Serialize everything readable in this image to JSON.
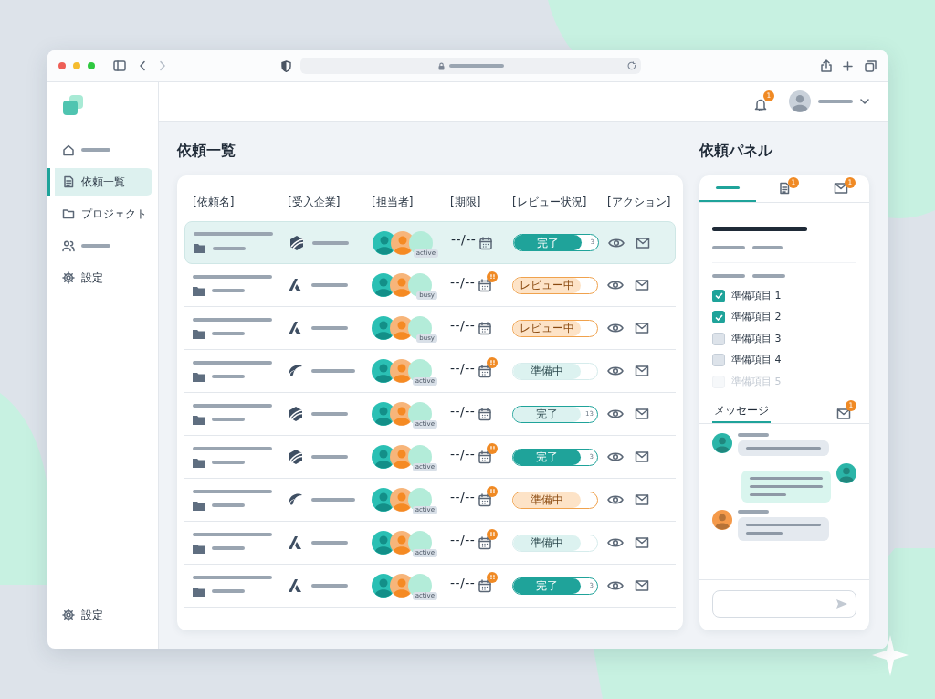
{
  "sidebar": {
    "items": [
      {
        "selected": false
      },
      {
        "label": "依頼一覧",
        "selected": true
      },
      {
        "label": "プロジェクト",
        "selected": false
      },
      {
        "selected": false
      },
      {
        "label": "設定",
        "selected": false
      }
    ],
    "footer": {
      "label": "設定"
    }
  },
  "header": {
    "notification_badge": "1"
  },
  "main": {
    "title": "依頼一覧",
    "table": {
      "columns": [
        "[依頼名]",
        "[受入企業]",
        "[担当者]",
        "[期限]",
        "[レビュー状況]",
        "[アクション]"
      ],
      "rows": [
        {
          "selected": true,
          "company": {
            "kind": "hex"
          },
          "status": "active",
          "deadline": "--/--",
          "review": {
            "label": "完了",
            "kind": "filled",
            "level": 0.8,
            "count": "3"
          }
        },
        {
          "selected": false,
          "company": {
            "kind": "peak"
          },
          "status": "busy",
          "deadline": "--/--",
          "alert": "!!",
          "review": {
            "label": "レビュー中",
            "kind": "warm",
            "level": 0.8
          }
        },
        {
          "selected": false,
          "company": {
            "kind": "peak"
          },
          "status": "busy",
          "deadline": "--/--",
          "review": {
            "label": "レビュー中",
            "kind": "warm",
            "level": 0.8
          }
        },
        {
          "selected": false,
          "company": {
            "kind": "swoosh"
          },
          "status": "active",
          "deadline": "--/--",
          "alert": "!!",
          "review": {
            "label": "準備中",
            "kind": "soft",
            "level": 0.8
          }
        },
        {
          "selected": false,
          "company": {
            "kind": "hex"
          },
          "status": "active",
          "deadline": "--/--",
          "review": {
            "label": "完了",
            "kind": "outlined",
            "level": 0.8,
            "count": "13"
          }
        },
        {
          "selected": false,
          "company": {
            "kind": "hex"
          },
          "status": "active",
          "deadline": "--/--",
          "alert": "!!",
          "review": {
            "label": "完了",
            "kind": "filled",
            "level": 0.8,
            "count": "3"
          }
        },
        {
          "selected": false,
          "company": {
            "kind": "swoosh"
          },
          "status": "active",
          "deadline": "--/--",
          "alert": "!!",
          "review": {
            "label": "準備中",
            "kind": "warm",
            "level": 0.8
          }
        },
        {
          "selected": false,
          "company": {
            "kind": "peak"
          },
          "status": "active",
          "deadline": "--/--",
          "alert": "!!",
          "review": {
            "label": "準備中",
            "kind": "soft",
            "level": 0.8
          }
        },
        {
          "selected": false,
          "company": {
            "kind": "peak"
          },
          "status": "active",
          "deadline": "--/--",
          "alert": "!!",
          "review": {
            "label": "完了",
            "kind": "filled",
            "level": 0.8,
            "count": "3"
          }
        }
      ]
    }
  },
  "panel": {
    "title": "依頼パネル",
    "tabs": [
      {
        "selected": true
      },
      {
        "badge": "1",
        "selected": false
      },
      {
        "badge": "1",
        "selected": false
      }
    ],
    "checklist": [
      {
        "label": "準備項目 1",
        "checked": true,
        "disabled": false
      },
      {
        "label": "準備項目 2",
        "checked": true,
        "disabled": false
      },
      {
        "label": "準備項目 3",
        "checked": false,
        "disabled": false
      },
      {
        "label": "準備項目 4",
        "checked": false,
        "disabled": false
      },
      {
        "label": "準備項目 5",
        "checked": false,
        "disabled": true
      }
    ],
    "messages_tab": {
      "label": "メッセージ",
      "selected": true,
      "badge": "1"
    },
    "messages": [
      {
        "kind": "incoming",
        "color": "#2bb5a8"
      },
      {
        "kind": "outgoing",
        "color": "#2bb5a8"
      },
      {
        "kind": "incoming",
        "color": "#f59a4a"
      }
    ]
  }
}
